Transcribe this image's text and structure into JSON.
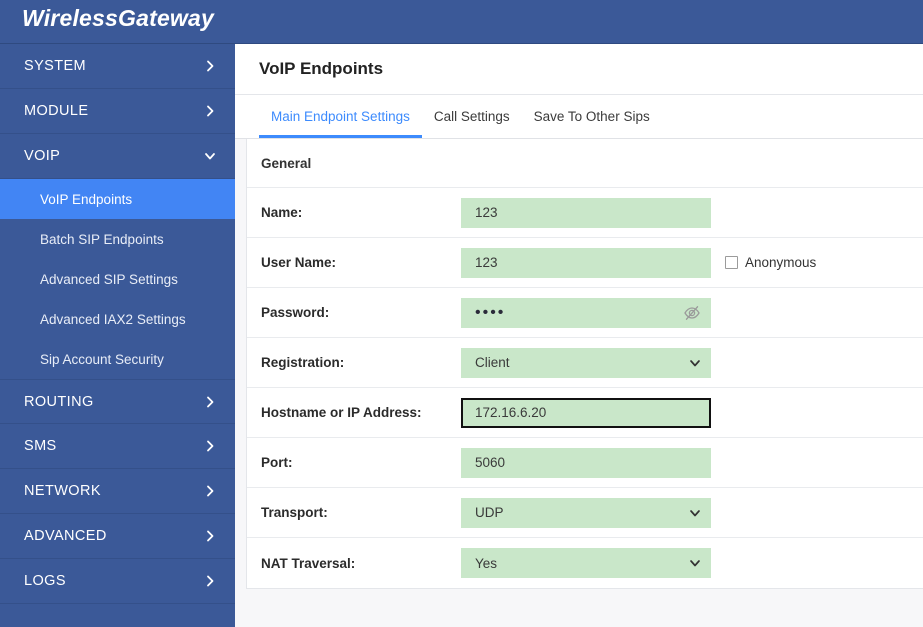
{
  "header": {
    "brand": "WirelessGateway"
  },
  "sidebar": {
    "groups": [
      {
        "label": "SYSTEM",
        "icon": "chevron-right-icon",
        "expanded": false
      },
      {
        "label": "MODULE",
        "icon": "chevron-right-icon",
        "expanded": false
      },
      {
        "label": "VOIP",
        "icon": "chevron-down-icon",
        "expanded": true
      }
    ],
    "voip_items": [
      {
        "label": "VoIP Endpoints",
        "active": true
      },
      {
        "label": "Batch SIP Endpoints",
        "active": false
      },
      {
        "label": "Advanced SIP Settings",
        "active": false
      },
      {
        "label": "Advanced IAX2 Settings",
        "active": false
      },
      {
        "label": "Sip Account Security",
        "active": false
      }
    ],
    "groups_lower": [
      {
        "label": "ROUTING",
        "icon": "chevron-right-icon"
      },
      {
        "label": "SMS",
        "icon": "chevron-right-icon"
      },
      {
        "label": "NETWORK",
        "icon": "chevron-right-icon"
      },
      {
        "label": "ADVANCED",
        "icon": "chevron-right-icon"
      },
      {
        "label": "LOGS",
        "icon": "chevron-right-icon"
      }
    ]
  },
  "main": {
    "page_title": "VoIP Endpoints",
    "tabs": [
      {
        "label": "Main Endpoint Settings",
        "active": true
      },
      {
        "label": "Call Settings",
        "active": false
      },
      {
        "label": "Save To Other Sips",
        "active": false
      }
    ],
    "section_title": "General",
    "fields": {
      "name_label": "Name:",
      "name_value": "123",
      "username_label": "User Name:",
      "username_value": "123",
      "anonymous_label": "Anonymous",
      "anonymous_checked": false,
      "password_label": "Password:",
      "password_masked": "••••",
      "password_toggle_icon": "eye-slash-icon",
      "registration_label": "Registration:",
      "registration_value": "Client",
      "hostname_label": "Hostname or IP Address:",
      "hostname_value": "172.16.6.20",
      "port_label": "Port:",
      "port_value": "5060",
      "transport_label": "Transport:",
      "transport_value": "UDP",
      "nat_label": "NAT Traversal:",
      "nat_value": "Yes"
    }
  },
  "colors": {
    "brand_blue": "#3b5998",
    "active_blue": "#4285f4",
    "tab_accent": "#3d8bfd",
    "field_green": "#c9e7c9"
  }
}
